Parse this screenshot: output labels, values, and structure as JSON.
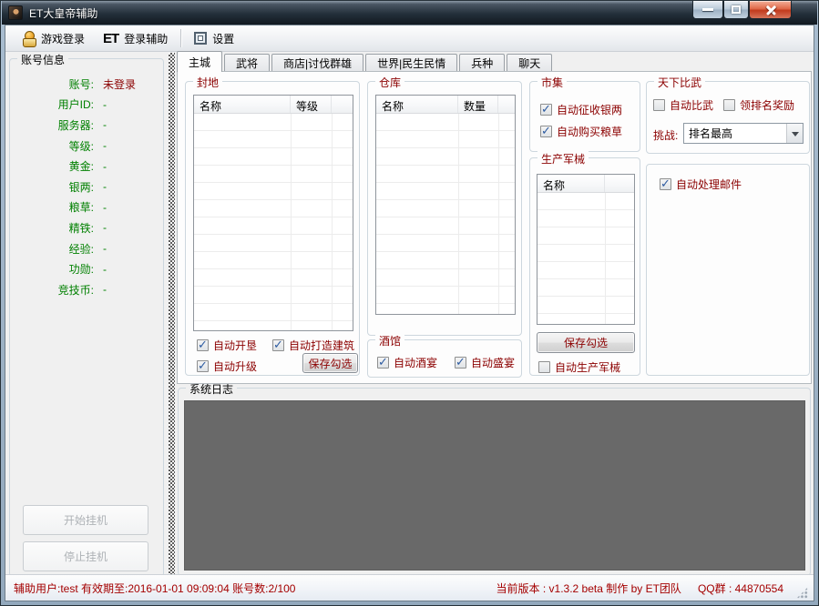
{
  "colors": {
    "label_green": "#008000",
    "label_maroon": "#8b0000",
    "status_red": "#a40000",
    "log_bg": "#696969",
    "close_button_red": "#c13a1d"
  },
  "titlebar": {
    "title": "ET大皇帝辅助"
  },
  "toolbar": {
    "game_login": "游戏登录",
    "et_logo": "ET",
    "login_helper": "登录辅助",
    "settings": "设置"
  },
  "account": {
    "title": "账号信息",
    "rows": [
      {
        "label": "账号:",
        "value": "未登录"
      },
      {
        "label": "用户ID:",
        "value": "-"
      },
      {
        "label": "服务器:",
        "value": "-"
      },
      {
        "label": "等级:",
        "value": "-"
      },
      {
        "label": "黄金:",
        "value": "-"
      },
      {
        "label": "银两:",
        "value": "-"
      },
      {
        "label": "粮草:",
        "value": "-"
      },
      {
        "label": "精铁:",
        "value": "-"
      },
      {
        "label": "经验:",
        "value": "-"
      },
      {
        "label": "功勋:",
        "value": "-"
      },
      {
        "label": "竞技币:",
        "value": "-"
      }
    ],
    "start_button": "开始挂机",
    "stop_button": "停止挂机"
  },
  "tabs": {
    "items": [
      {
        "label": "主城",
        "active": true
      },
      {
        "label": "武将",
        "active": false
      },
      {
        "label": "商店|讨伐群雄",
        "active": false
      },
      {
        "label": "世界|民生民情",
        "active": false
      },
      {
        "label": "兵种",
        "active": false
      },
      {
        "label": "聊天",
        "active": false
      }
    ]
  },
  "main": {
    "fief": {
      "title": "封地",
      "col_name": "名称",
      "col_level": "等级",
      "cb_reclaim": {
        "label": "自动开垦",
        "checked": true
      },
      "cb_build": {
        "label": "自动打造建筑",
        "checked": true
      },
      "cb_upgrade": {
        "label": "自动升级",
        "checked": true
      },
      "save_button": "保存勾选"
    },
    "warehouse": {
      "title": "仓库",
      "col_name": "名称",
      "col_qty": "数量"
    },
    "tavern": {
      "title": "酒馆",
      "cb_banquet": {
        "label": "自动酒宴",
        "checked": true
      },
      "cb_feast": {
        "label": "自动盛宴",
        "checked": true
      }
    },
    "market": {
      "title": "市集",
      "cb_collect": {
        "label": "自动征收银两",
        "checked": true
      },
      "cb_buy": {
        "label": "自动购买粮草",
        "checked": true
      }
    },
    "weapons": {
      "title": "生产军械",
      "col_name": "名称",
      "save_button": "保存勾选",
      "cb_produce": {
        "label": "自动生产军械",
        "checked": false
      }
    },
    "tournament": {
      "title": "天下比武",
      "cb_duel": {
        "label": "自动比武",
        "checked": false
      },
      "cb_reward": {
        "label": "领排名奖励",
        "checked": false
      },
      "challenge_label": "挑战:",
      "challenge_value": "排名最高"
    },
    "mail": {
      "cb_mail": {
        "label": "自动处理邮件",
        "checked": true
      }
    }
  },
  "log": {
    "title": "系统日志"
  },
  "statusbar": {
    "left": "辅助用户:test 有效期至:2016-01-01 09:09:04 账号数:2/100",
    "version": "当前版本 : v1.3.2  beta  制作 by ET团队",
    "qq": "QQ群 : 44870554"
  }
}
